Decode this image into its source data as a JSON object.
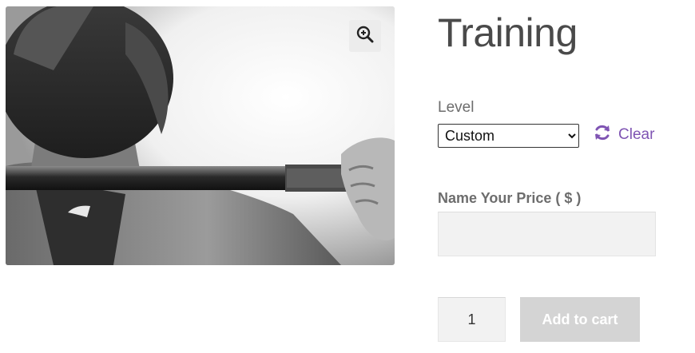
{
  "product": {
    "title": "Training",
    "image_alt": "Person holding a barbell across shoulders (black and white)"
  },
  "image_actions": {
    "zoom_icon": "magnifier-plus-icon"
  },
  "variation": {
    "label": "Level",
    "selected": "Custom",
    "clear_label": "Clear",
    "clear_icon": "refresh-icon"
  },
  "nyp": {
    "label": "Name Your Price ( $ )",
    "value": ""
  },
  "cart": {
    "quantity": "1",
    "add_label": "Add to cart"
  },
  "colors": {
    "accent": "#7f54b3",
    "button_disabled": "#d4d4d4",
    "field_bg": "#f2f2f2"
  }
}
